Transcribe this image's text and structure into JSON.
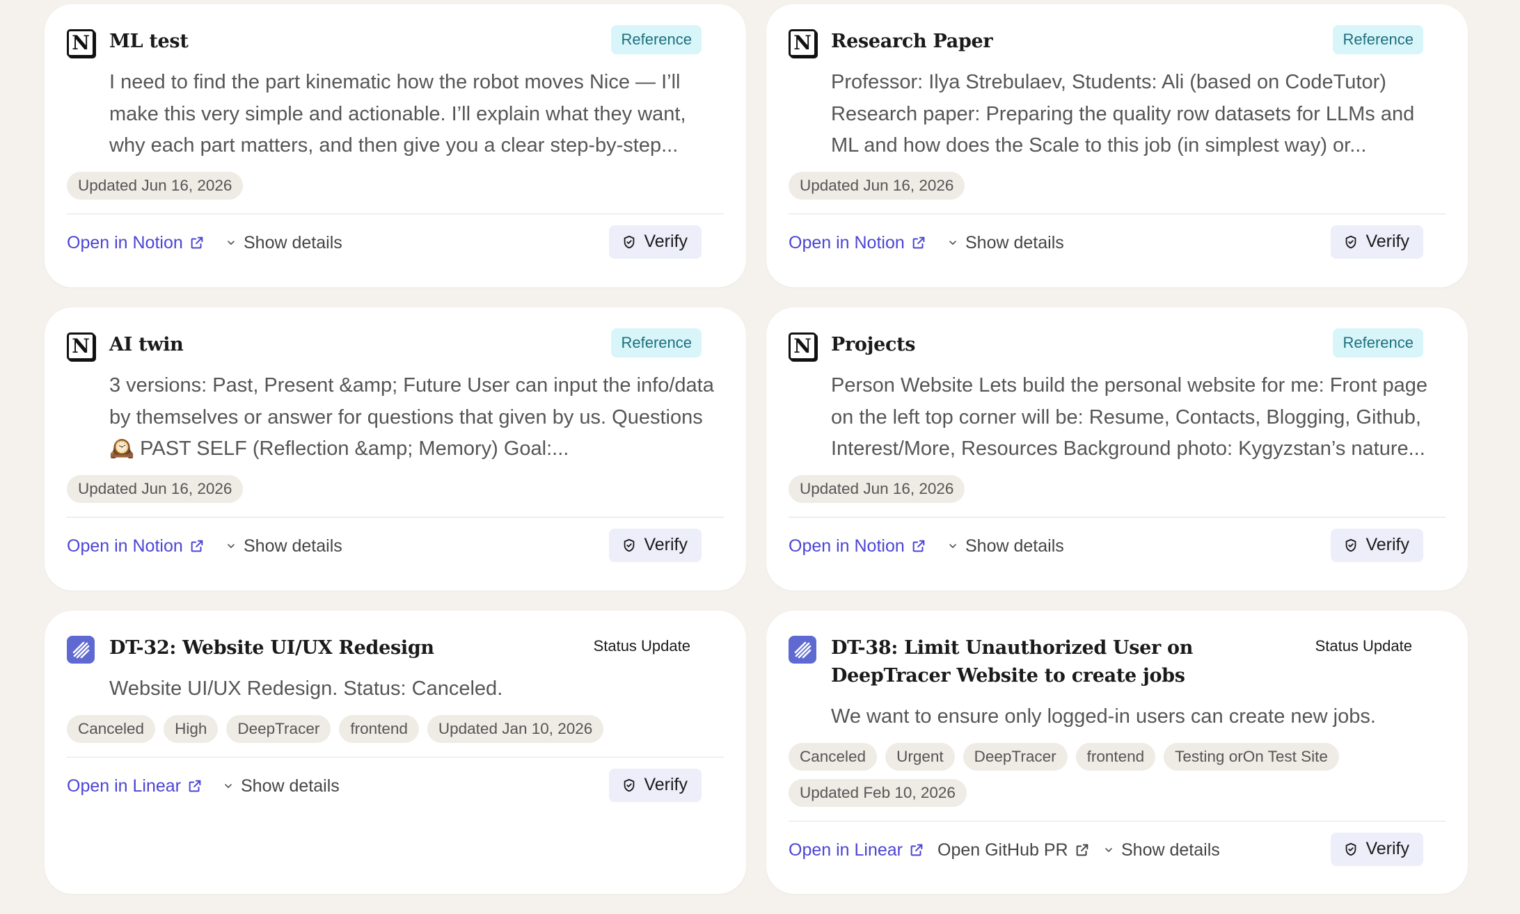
{
  "cards": [
    {
      "title": "ML test",
      "badge": "Reference",
      "body": "I need to find the part kinematic how the robot moves Nice — I’ll make this very simple and actionable. I’ll explain what they want, why each part matters, and then give you a clear step-by-step...",
      "tags": [
        "Updated Jun 16, 2026"
      ],
      "open_link": "Open in Notion",
      "details": "Show details",
      "verify": "Verify"
    },
    {
      "title": "Research Paper",
      "badge": "Reference",
      "body": "Professor: Ilya Strebulaev, Students: Ali (based on CodeTutor) Research paper: Preparing the quality row datasets for LLMs and ML and how does the Scale to this job (in simplest way) or...",
      "tags": [
        "Updated Jun 16, 2026"
      ],
      "open_link": "Open in Notion",
      "details": "Show details",
      "verify": "Verify"
    },
    {
      "title": "AI twin",
      "badge": "Reference",
      "body": "3 versions: Past, Present &amp; Future User can input the info/data by themselves or answer for questions that given by us. Questions 🕰️ PAST SELF (Reflection &amp; Memory) Goal:...",
      "tags": [
        "Updated Jun 16, 2026"
      ],
      "open_link": "Open in Notion",
      "details": "Show details",
      "verify": "Verify"
    },
    {
      "title": "Projects",
      "badge": "Reference",
      "body": "Person Website Lets build the personal website for me: Front page on the left top corner will be: Resume, Contacts, Blogging, Github, Interest/More, Resources Background photo: Kygyzstan’s nature...",
      "tags": [
        "Updated Jun 16, 2026"
      ],
      "open_link": "Open in Notion",
      "details": "Show details",
      "verify": "Verify"
    },
    {
      "title": "DT-32: Website UI/UX Redesign",
      "badge": "Status Update",
      "body": "Website UI/UX Redesign. Status: Canceled.",
      "tags": [
        "Canceled",
        "High",
        "DeepTracer",
        "frontend",
        "Updated Jan 10, 2026"
      ],
      "open_link": "Open in Linear",
      "details": "Show details",
      "verify": "Verify"
    },
    {
      "title": "DT-38: Limit Unauthorized User on DeepTracer Website to create jobs",
      "badge": "Status Update",
      "body": "We want to ensure only logged-in users can create new jobs.",
      "tags": [
        "Canceled",
        "Urgent",
        "DeepTracer",
        "frontend",
        "Testing orOn Test Site",
        "Updated Feb 10, 2026"
      ],
      "open_link": "Open in Linear",
      "github_link": "Open GitHub PR",
      "details": "Show details",
      "verify": "Verify"
    }
  ]
}
